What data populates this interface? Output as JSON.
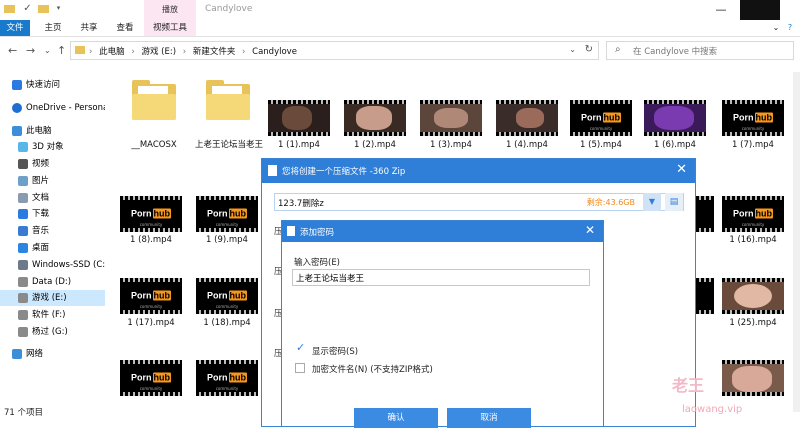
{
  "window": {
    "title": "Candylove",
    "context_tab_group": "播放"
  },
  "ribbon": {
    "tabs": [
      "文件",
      "主页",
      "共享",
      "查看",
      "视频工具"
    ]
  },
  "address": {
    "path": [
      "此电脑",
      "游戏 (E:)",
      "新建文件夹",
      "Candylove"
    ],
    "search_placeholder": "在 Candylove 中搜索"
  },
  "nav": {
    "items": [
      {
        "label": "快速访问",
        "icon": "star-icon",
        "color": "#2a7ae2"
      },
      {
        "label": "OneDrive - Persona",
        "icon": "cloud-icon",
        "color": "#1f6fd1"
      },
      {
        "label": "此电脑",
        "icon": "computer-icon",
        "color": "#3b8fd9"
      },
      {
        "label": "3D 对象",
        "icon": "cube-icon",
        "color": "#58b6e8"
      },
      {
        "label": "视频",
        "icon": "video-icon",
        "color": "#555"
      },
      {
        "label": "图片",
        "icon": "picture-icon",
        "color": "#6fa0c9"
      },
      {
        "label": "文档",
        "icon": "document-icon",
        "color": "#8a9bb0"
      },
      {
        "label": "下载",
        "icon": "download-icon",
        "color": "#2a7ae2"
      },
      {
        "label": "音乐",
        "icon": "music-icon",
        "color": "#3a7ad0"
      },
      {
        "label": "桌面",
        "icon": "desktop-icon",
        "color": "#2a86e0"
      },
      {
        "label": "Windows-SSD (C:)",
        "icon": "drive-icon",
        "color": "#6c7a89"
      },
      {
        "label": "Data (D:)",
        "icon": "drive-icon",
        "color": "#8a8a8a"
      },
      {
        "label": "游戏 (E:)",
        "icon": "drive-icon",
        "color": "#8a8a8a"
      },
      {
        "label": "软件 (F:)",
        "icon": "drive-icon",
        "color": "#8a8a8a"
      },
      {
        "label": "杨过 (G:)",
        "icon": "drive-icon",
        "color": "#8a8a8a"
      },
      {
        "label": "网络",
        "icon": "network-icon",
        "color": "#3b8fd9"
      }
    ]
  },
  "files": {
    "folders": [
      "__MACOSX",
      "上老王论坛当老王"
    ],
    "videos": [
      "1 (1).mp4",
      "1 (2).mp4",
      "1 (3).mp4",
      "1 (4).mp4",
      "1 (5).mp4",
      "1 (6).mp4",
      "1 (7).mp4",
      "1 (8).mp4",
      "1 (9).mp4",
      "1 (16).mp4",
      "1 (17).mp4",
      "1 (18).mp4",
      "1 (25).mp4"
    ],
    "logo_word": "Porn",
    "logo_badge": "hub",
    "logo_sub": "community"
  },
  "status": {
    "item_count": "71 个项目"
  },
  "zip_dialog": {
    "title": "您将创建一个压缩文件 -360 Zip",
    "path_value": "123.7删除z",
    "free_space": "剩余:43.6GB",
    "side_label": "压"
  },
  "password_dialog": {
    "title": "添加密码",
    "input_label": "输入密码(E)",
    "password_value": "上老王论坛当老王",
    "show_password": "显示密码(S)",
    "encrypt_names": "加密文件名(N) (不支持ZIP格式)",
    "ok": "确认",
    "cancel": "取消"
  },
  "watermark": {
    "site": "laowang.vip"
  }
}
